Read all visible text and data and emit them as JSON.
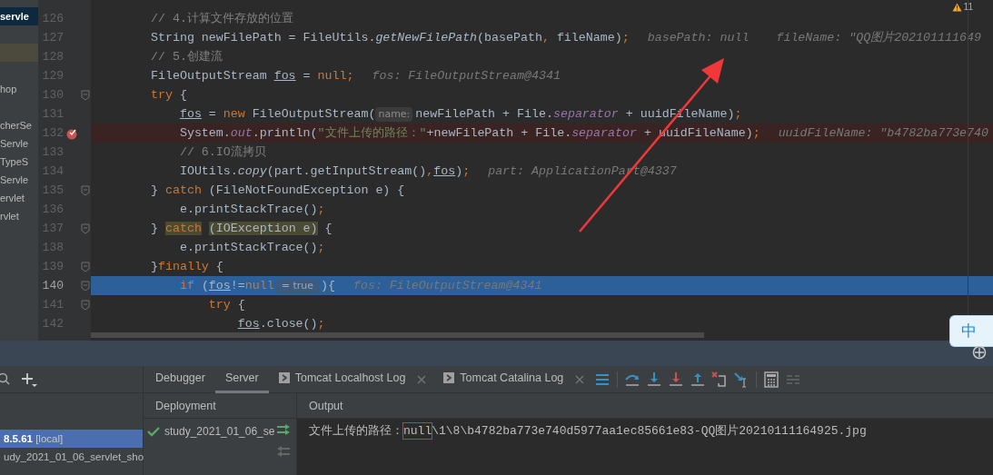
{
  "project_tree": [
    {
      "label": "servle",
      "kind": "selected"
    },
    {
      "kind": "marker"
    },
    {
      "label": "hop",
      "kind": "plain"
    },
    {
      "label": "cherSe",
      "kind": "plain"
    },
    {
      "label": "Servle",
      "kind": "plain"
    },
    {
      "label": "TypeS",
      "kind": "plain"
    },
    {
      "label": "Servle",
      "kind": "plain"
    },
    {
      "label": "ervlet",
      "kind": "plain"
    },
    {
      "label": "rvlet",
      "kind": "plain"
    }
  ],
  "editor": {
    "warning_count": "11",
    "lines": [
      {
        "number": "126",
        "fold": false,
        "breakpoint": false,
        "current": false,
        "tokens": [
          {
            "text": "// 4.计算文件存放的位置",
            "kind": "comment"
          }
        ]
      },
      {
        "number": "127",
        "fold": false,
        "breakpoint": false,
        "current": false,
        "tokens": [
          {
            "text": "String newFilePath = FileUtils.",
            "kind": "plain"
          },
          {
            "text": "getNewFilePath",
            "kind": "method"
          },
          {
            "text": "(basePath",
            "kind": "plain"
          },
          {
            "text": ",",
            "kind": "punct"
          },
          {
            "text": " fileName)",
            "kind": "plain"
          },
          {
            "text": ";",
            "kind": "punct"
          },
          {
            "text": "basePath: null",
            "kind": "hint"
          },
          {
            "text": "fileName: \"QQ图片202101111649",
            "kind": "hint"
          }
        ]
      },
      {
        "number": "128",
        "fold": false,
        "breakpoint": false,
        "current": false,
        "tokens": [
          {
            "text": "// 5.创建流",
            "kind": "comment"
          }
        ]
      },
      {
        "number": "129",
        "fold": false,
        "breakpoint": false,
        "current": false,
        "tokens": [
          {
            "text": "FileOutputStream ",
            "kind": "plain"
          },
          {
            "text": "fos",
            "kind": "ref"
          },
          {
            "text": " = ",
            "kind": "plain"
          },
          {
            "text": "null",
            "kind": "keyword"
          },
          {
            "text": ";",
            "kind": "punct"
          },
          {
            "text": "fos: FileOutputStream@4341",
            "kind": "hint"
          }
        ]
      },
      {
        "number": "130",
        "fold": true,
        "breakpoint": false,
        "current": false,
        "tokens": [
          {
            "text": "try",
            "kind": "keyword"
          },
          {
            "text": " {",
            "kind": "plain"
          }
        ]
      },
      {
        "number": "131",
        "fold": false,
        "breakpoint": false,
        "current": false,
        "tokens": [
          {
            "text": "    fos",
            "kind": "ref"
          },
          {
            "text": " = ",
            "kind": "plain"
          },
          {
            "text": "new",
            "kind": "keyword"
          },
          {
            "text": " FileOutputStream(",
            "kind": "plain"
          },
          {
            "text": "name:",
            "kind": "param"
          },
          {
            "text": "newFilePath + File.",
            "kind": "plain"
          },
          {
            "text": "separator",
            "kind": "field"
          },
          {
            "text": " + uuidFileName)",
            "kind": "plain"
          },
          {
            "text": ";",
            "kind": "punct"
          }
        ]
      },
      {
        "number": "132",
        "fold": false,
        "breakpoint": true,
        "current": false,
        "tokens": [
          {
            "text": "    System.",
            "kind": "plain"
          },
          {
            "text": "out",
            "kind": "field"
          },
          {
            "text": ".println(",
            "kind": "plain"
          },
          {
            "text": "\"文件上传的路径：\"",
            "kind": "string"
          },
          {
            "text": "+newFilePath + File.",
            "kind": "plain"
          },
          {
            "text": "separator",
            "kind": "field"
          },
          {
            "text": " + uuidFileName)",
            "kind": "plain"
          },
          {
            "text": ";",
            "kind": "punct"
          },
          {
            "text": "uuidFileName: \"b4782ba773e740",
            "kind": "hint"
          }
        ]
      },
      {
        "number": "133",
        "fold": false,
        "breakpoint": false,
        "current": false,
        "tokens": [
          {
            "text": "    // 6.IO流拷贝",
            "kind": "comment"
          }
        ]
      },
      {
        "number": "134",
        "fold": false,
        "breakpoint": false,
        "current": false,
        "tokens": [
          {
            "text": "    IOUtils.",
            "kind": "plain"
          },
          {
            "text": "copy",
            "kind": "method"
          },
          {
            "text": "(part.getInputStream()",
            "kind": "plain"
          },
          {
            "text": ",",
            "kind": "punct"
          },
          {
            "text": "fos",
            "kind": "ref"
          },
          {
            "text": ")",
            "kind": "plain"
          },
          {
            "text": ";",
            "kind": "punct"
          },
          {
            "text": "part: ApplicationPart@4337",
            "kind": "hint"
          }
        ]
      },
      {
        "number": "135",
        "fold": true,
        "breakpoint": false,
        "current": false,
        "tokens": [
          {
            "text": "} ",
            "kind": "plain"
          },
          {
            "text": "catch",
            "kind": "keyword"
          },
          {
            "text": " (FileNotFoundException e) {",
            "kind": "plain"
          }
        ]
      },
      {
        "number": "136",
        "fold": false,
        "breakpoint": false,
        "current": false,
        "tokens": [
          {
            "text": "    e.printStackTrace()",
            "kind": "plain"
          },
          {
            "text": ";",
            "kind": "punct"
          }
        ]
      },
      {
        "number": "137",
        "fold": true,
        "breakpoint": false,
        "current": false,
        "tokens": [
          {
            "text": "} ",
            "kind": "plain"
          },
          {
            "text": "catch",
            "kind": "match-keyword"
          },
          {
            "text": " (IOException e)",
            "kind": "match"
          },
          {
            "text": " {",
            "kind": "plain"
          }
        ]
      },
      {
        "number": "138",
        "fold": false,
        "breakpoint": false,
        "current": false,
        "tokens": [
          {
            "text": "    e.printStackTrace()",
            "kind": "plain"
          },
          {
            "text": ";",
            "kind": "punct"
          }
        ]
      },
      {
        "number": "139",
        "fold": true,
        "breakpoint": false,
        "current": false,
        "tokens": [
          {
            "text": "}",
            "kind": "plain"
          },
          {
            "text": "finally",
            "kind": "keyword"
          },
          {
            "text": " {",
            "kind": "plain"
          }
        ]
      },
      {
        "number": "140",
        "fold": true,
        "breakpoint": false,
        "current": true,
        "tokens": [
          {
            "text": "    if",
            "kind": "keyword"
          },
          {
            "text": " (",
            "kind": "plain"
          },
          {
            "text": "fos",
            "kind": "ref"
          },
          {
            "text": "!=",
            "kind": "plain"
          },
          {
            "text": "null",
            "kind": "keyword"
          },
          {
            "text": "= true",
            "kind": "value"
          },
          {
            "text": "){",
            "kind": "plain"
          },
          {
            "text": "fos: FileOutputStream@4341",
            "kind": "hint"
          }
        ]
      },
      {
        "number": "141",
        "fold": true,
        "breakpoint": false,
        "current": false,
        "tokens": [
          {
            "text": "        try",
            "kind": "keyword"
          },
          {
            "text": " {",
            "kind": "plain"
          }
        ]
      },
      {
        "number": "142",
        "fold": false,
        "breakpoint": false,
        "current": false,
        "tokens": [
          {
            "text": "            fos",
            "kind": "ref"
          },
          {
            "text": ".close()",
            "kind": "plain"
          },
          {
            "text": ";",
            "kind": "punct"
          }
        ]
      }
    ]
  },
  "annotation_arrow": true,
  "ime": {
    "label": "中"
  },
  "services": {
    "items": [
      {
        "label": "8.5.61",
        "suffix": "[local]",
        "selected": true
      },
      {
        "label": "udy_2021_01_06_servlet_sho",
        "selected": false
      }
    ]
  },
  "tabs": [
    {
      "label": "Debugger",
      "selected": false,
      "kind": "view"
    },
    {
      "label": "Server",
      "selected": true,
      "kind": "view"
    },
    {
      "label": "Tomcat Localhost Log",
      "selected": false,
      "kind": "log"
    },
    {
      "label": "Tomcat Catalina Log",
      "selected": false,
      "kind": "log"
    }
  ],
  "debug_toolbar": [
    {
      "kind": "menu",
      "disabled": false
    },
    {
      "kind": "separator"
    },
    {
      "kind": "step-over",
      "disabled": false
    },
    {
      "kind": "step-into",
      "disabled": false
    },
    {
      "kind": "force-step-into",
      "disabled": false
    },
    {
      "kind": "step-out",
      "disabled": false
    },
    {
      "kind": "drop-frame",
      "disabled": false
    },
    {
      "kind": "run-to-cursor",
      "disabled": false
    },
    {
      "kind": "separator"
    },
    {
      "kind": "evaluate",
      "disabled": false
    },
    {
      "kind": "trace",
      "disabled": true
    }
  ],
  "deployment": {
    "header": "Deployment",
    "items": [
      {
        "label": "study_2021_01_06_se",
        "deployed": true
      }
    ]
  },
  "output": {
    "header": "Output",
    "segments": [
      {
        "text": "文件上传的路径：",
        "boxed": false
      },
      {
        "text": "null",
        "boxed": true
      },
      {
        "text": "\\1\\8\\b4782ba773e740d5977aa1ec85661e83-QQ图片20210111164925.jpg",
        "boxed": false
      }
    ]
  }
}
